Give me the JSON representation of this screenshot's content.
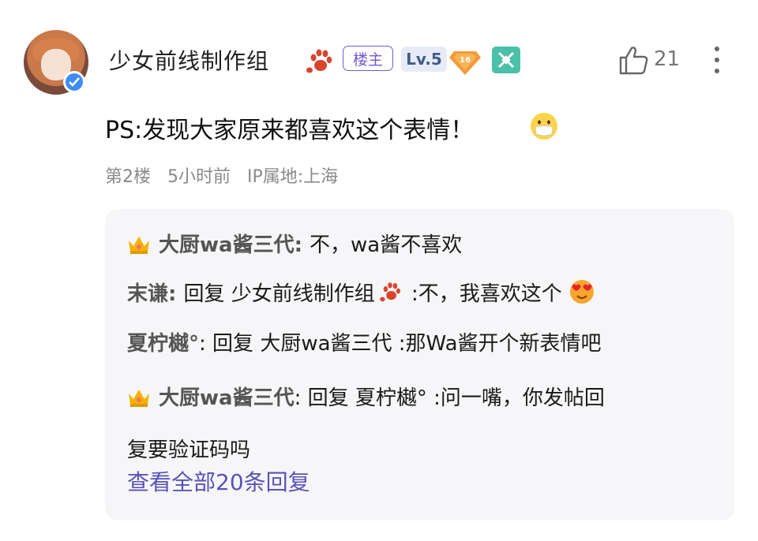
{
  "post": {
    "username": "少女前线制作组",
    "owner_tag": "楼主",
    "level": "Lv.5",
    "level_gem": "16",
    "likes": "21",
    "text": "PS:发现大家原来都喜欢这个表情！",
    "floor": "第2楼",
    "time": "5小时前",
    "ip": "IP属地:上海"
  },
  "replies": [
    {
      "name": "大厨wa酱三代",
      "sep": ": ",
      "text": "不，wa酱不喜欢",
      "icon": "crown-icon"
    },
    {
      "name": "末谦",
      "sep": ": ",
      "reply_word": "回复",
      "target": "少女前线制作组",
      "text": ":不，我喜欢这个",
      "icon": "heart-eyes-emoji"
    },
    {
      "name": "夏柠樾°",
      "sep": ": ",
      "reply_word": "回复",
      "target": "大厨wa酱三代",
      "text": ":那Wa酱开个新表情吧"
    },
    {
      "name": "大厨wa酱三代",
      "sep": ": ",
      "reply_word": "回复",
      "target": "夏柠樾°",
      "text_line1": ":问一嘴，你发帖回",
      "text_line2": "复要验证码吗",
      "icon": "crown-icon"
    }
  ],
  "view_all": "查看全部20条回复",
  "colors": {
    "accent": "#6d5cd4",
    "link": "#5b52b8",
    "verify": "#3d8df5",
    "game_badge": "#4bc0a8",
    "level_bg": "#e6ecf7"
  }
}
